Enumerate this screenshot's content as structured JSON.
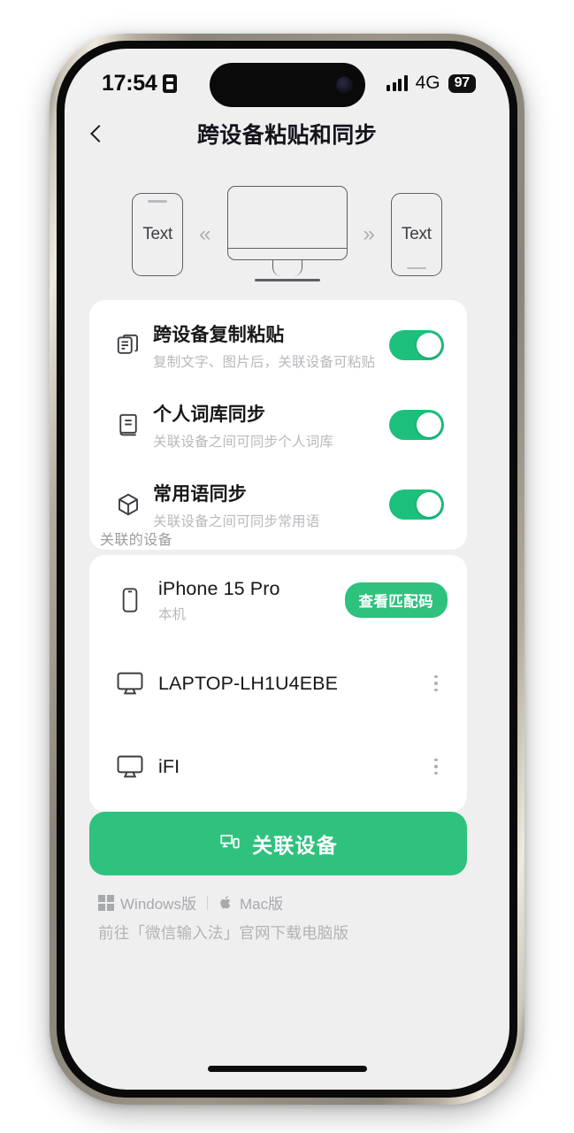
{
  "status_bar": {
    "time": "17:54",
    "badge_icon": "app-badge-icon",
    "signal_icon": "signal-bars-icon",
    "network": "4G",
    "battery": "97"
  },
  "nav": {
    "back_icon": "back-chevron-icon",
    "title": "跨设备粘贴和同步"
  },
  "hero": {
    "left_device_label": "Text",
    "left_arrow": "«",
    "right_arrow": "»",
    "right_device_label": "Text",
    "monitor_icon": "desktop-monitor-icon"
  },
  "settings": {
    "rows": [
      {
        "icon": "copy-paste-icon",
        "title": "跨设备复制粘贴",
        "subtitle": "复制文字、图片后，关联设备可粘贴",
        "toggle_state": "on"
      },
      {
        "icon": "dictionary-book-icon",
        "title": "个人词库同步",
        "subtitle": "关联设备之间可同步个人词库",
        "toggle_state": "on"
      },
      {
        "icon": "cube-icon",
        "title": "常用语同步",
        "subtitle": "关联设备之间可同步常用语",
        "toggle_state": "on"
      }
    ]
  },
  "devices": {
    "section_label": "关联的设备",
    "items": [
      {
        "icon": "phone-icon",
        "name": "iPhone 15 Pro",
        "subtitle": "本机",
        "action_label": "查看匹配码",
        "action_type": "pill-button"
      },
      {
        "icon": "monitor-icon",
        "name": "LAPTOP-LH1U4EBE",
        "subtitle": "",
        "action_label": "",
        "action_type": "kebab-menu"
      },
      {
        "icon": "monitor-icon",
        "name": "iFI",
        "subtitle": "",
        "action_label": "",
        "action_type": "kebab-menu"
      }
    ]
  },
  "primary_action": {
    "icon": "link-device-icon",
    "label": "关联设备"
  },
  "footer": {
    "windows_label": "Windows版",
    "windows_icon": "windows-logo-icon",
    "mac_label": "Mac版",
    "mac_icon": "apple-logo-icon",
    "note": "前往「微信输入法」官网下载电脑版"
  },
  "colors": {
    "accent_green": "#2ec27e",
    "toggle_green": "#1cc07c",
    "screen_background": "#efeff0",
    "card_background": "#ffffff"
  }
}
